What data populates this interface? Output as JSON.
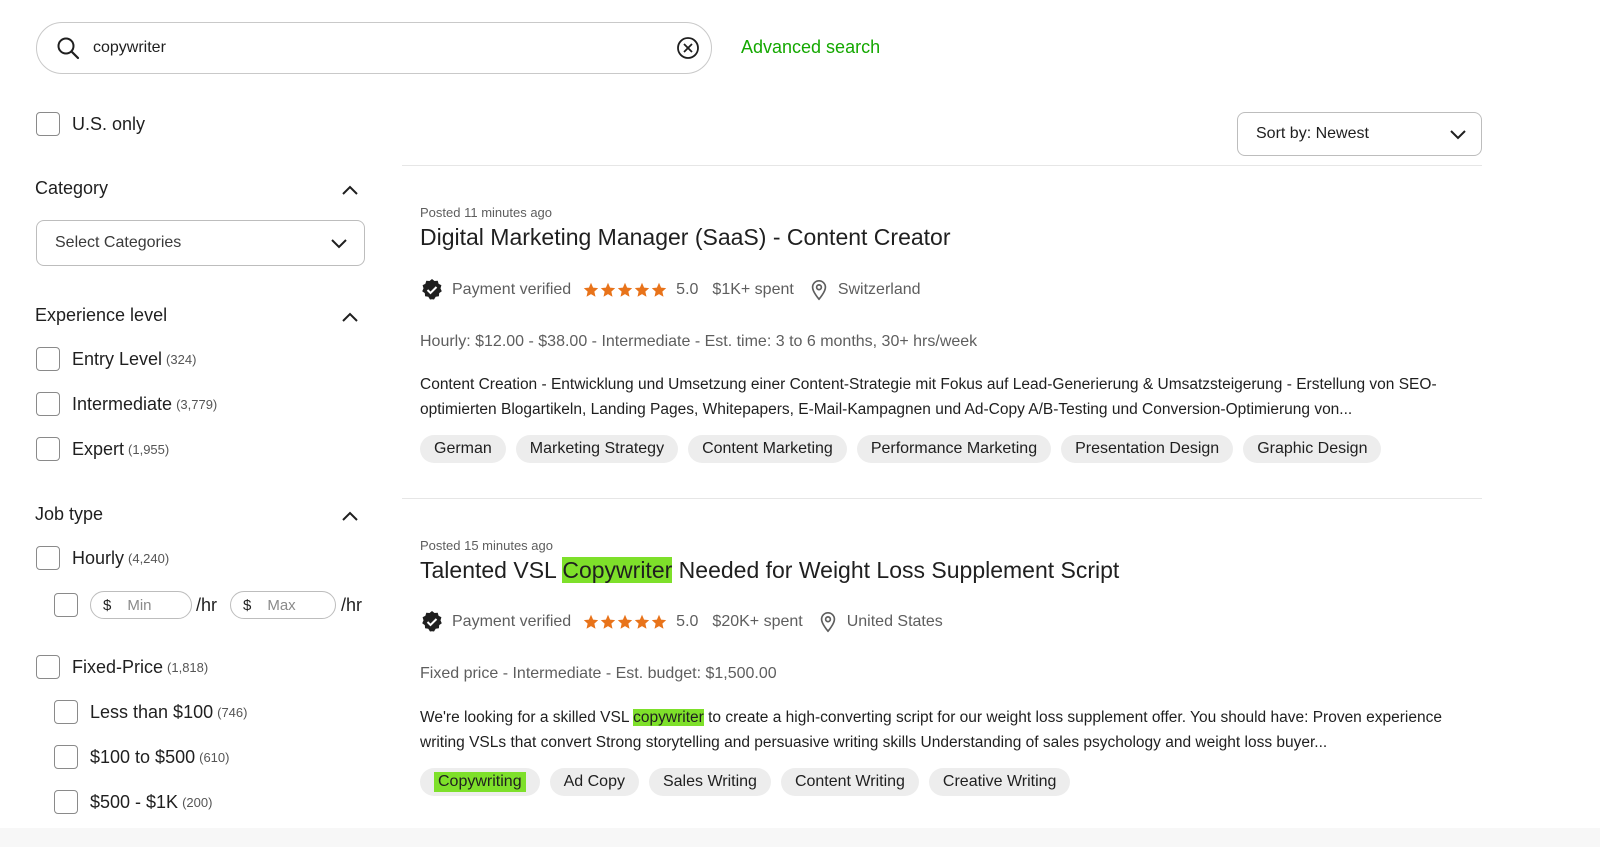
{
  "search": {
    "value": "copywriter",
    "advanced_label": "Advanced search"
  },
  "sidebar": {
    "us_only": "U.S. only",
    "category": {
      "title": "Category",
      "select_label": "Select Categories"
    },
    "experience": {
      "title": "Experience level",
      "items": [
        {
          "label": "Entry Level",
          "count": "(324)"
        },
        {
          "label": "Intermediate",
          "count": "(3,779)"
        },
        {
          "label": "Expert",
          "count": "(1,955)"
        }
      ]
    },
    "job_type": {
      "title": "Job type",
      "hourly": {
        "label": "Hourly",
        "count": "(4,240)"
      },
      "rate": {
        "currency": "$",
        "min_placeholder": "Min",
        "max_placeholder": "Max",
        "unit": "/hr"
      },
      "fixed": {
        "label": "Fixed-Price",
        "count": "(1,818)"
      },
      "fixed_ranges": [
        {
          "label": "Less than $100",
          "count": "(746)"
        },
        {
          "label": "$100 to $500",
          "count": "(610)"
        },
        {
          "label": "$500 - $1K",
          "count": "(200)"
        }
      ]
    }
  },
  "sort": {
    "label": "Sort by: Newest"
  },
  "jobs": [
    {
      "posted": "Posted 11 minutes ago",
      "title": "Digital Marketing Manager (SaaS) - Content Creator",
      "payment": "Payment verified",
      "rating": "5.0",
      "stars": 5,
      "spent": "$1K+ spent",
      "location": "Switzerland",
      "terms": "Hourly: $12.00 - $38.00 - Intermediate - Est. time: 3 to 6 months, 30+ hrs/week",
      "description": "Content Creation - Entwicklung und Umsetzung einer Content-Strategie mit Fokus auf Lead-Generierung & Umsatzsteigerung - Erstellung von SEO-optimierten Blogartikeln, Landing Pages, Whitepapers, E-Mail-Kampagnen und Ad-Copy A/B-Testing und Conversion-Optimierung von...",
      "tags": [
        "German",
        "Marketing Strategy",
        "Content Marketing",
        "Performance Marketing",
        "Presentation Design",
        "Graphic Design"
      ]
    },
    {
      "posted": "Posted 15 minutes ago",
      "title_pre": "Talented VSL ",
      "title_hl": "Copywriter",
      "title_post": " Needed for Weight Loss Supplement Script",
      "payment": "Payment verified",
      "rating": "5.0",
      "stars": 5,
      "spent": "$20K+ spent",
      "location": "United States",
      "terms": "Fixed price - Intermediate - Est. budget: $1,500.00",
      "desc_pre": "We're looking for a skilled VSL ",
      "desc_hl": "copywriter",
      "desc_post": " to create a high-converting script for our weight loss supplement offer. You should have: Proven experience writing VSLs that convert Strong storytelling and persuasive writing skills Understanding of sales psychology and weight loss buyer...",
      "tags": [
        "Copywriting",
        "Ad Copy",
        "Sales Writing",
        "Content Writing",
        "Creative Writing"
      ]
    }
  ],
  "colors": {
    "accent": "#14a800",
    "highlight": "#7ee02a",
    "star": "#e8731a"
  }
}
